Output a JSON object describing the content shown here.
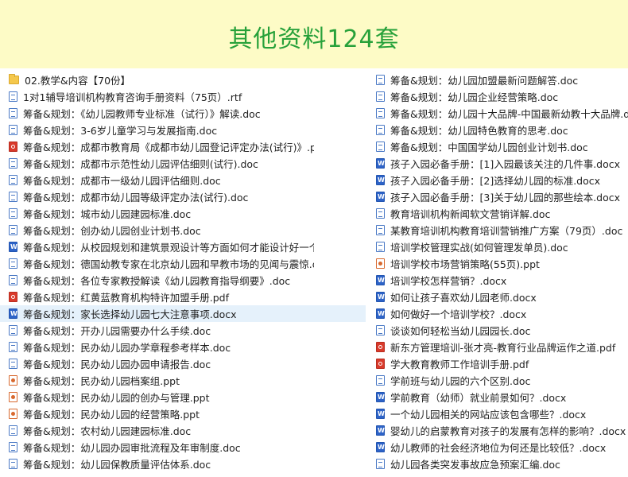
{
  "banner": {
    "title": "其他资料124套"
  },
  "left_items": [
    {
      "icon": "folder",
      "name": "02.教学&内容【70份】"
    },
    {
      "icon": "doc",
      "name": "1对1辅导培训机构教育咨询手册资料（75页）.rtf"
    },
    {
      "icon": "doc",
      "name": "筹备&规划：《幼儿园教师专业标准（试行）》解读.doc"
    },
    {
      "icon": "doc",
      "name": "筹备&规划：3-6岁儿童学习与发展指南.doc"
    },
    {
      "icon": "pdf",
      "name": "筹备&规划：成都市教育局《成都市幼儿园登记评定办法(试行)》.pdf"
    },
    {
      "icon": "doc",
      "name": "筹备&规划：成都市示范性幼儿园评估细则(试行).doc"
    },
    {
      "icon": "doc",
      "name": "筹备&规划：成都市一级幼儿园评估细则.doc"
    },
    {
      "icon": "doc",
      "name": "筹备&规划：成都市幼儿园等级评定办法(试行).doc"
    },
    {
      "icon": "doc",
      "name": "筹备&规划：城市幼儿园建园标准.doc"
    },
    {
      "icon": "doc",
      "name": "筹备&规划：创办幼儿园创业计划书.doc"
    },
    {
      "icon": "docx",
      "name": "筹备&规划：从校园规划和建筑景观设计等方面如何才能设计好一个学校？.docx"
    },
    {
      "icon": "doc",
      "name": "筹备&规划：德国幼教专家在北京幼儿园和早教市场的见闻与震惊.doc"
    },
    {
      "icon": "doc",
      "name": "筹备&规划：各位专家教授解读《幼儿园教育指导纲要》.doc"
    },
    {
      "icon": "pdf",
      "name": "筹备&规划：红黄蓝教育机构特许加盟手册.pdf"
    },
    {
      "icon": "docx",
      "name": "筹备&规划：家长选择幼儿园七大注意事项.docx",
      "selected": true
    },
    {
      "icon": "doc",
      "name": "筹备&规划：开办儿园需要办什么手续.doc"
    },
    {
      "icon": "doc",
      "name": "筹备&规划：民办幼儿园办学章程参考样本.doc"
    },
    {
      "icon": "doc",
      "name": "筹备&规划：民办幼儿园办园申请报告.doc"
    },
    {
      "icon": "ppt",
      "name": "筹备&规划：民办幼儿园档案组.ppt"
    },
    {
      "icon": "ppt",
      "name": "筹备&规划：民办幼儿园的创办与管理.ppt"
    },
    {
      "icon": "ppt",
      "name": "筹备&规划：民办幼儿园的经营策略.ppt"
    },
    {
      "icon": "doc",
      "name": "筹备&规划：农村幼儿园建园标准.doc"
    },
    {
      "icon": "doc",
      "name": "筹备&规划：幼儿园办园审批流程及年审制度.doc"
    },
    {
      "icon": "doc",
      "name": "筹备&规划：幼儿园保教质量评估体系.doc"
    }
  ],
  "right_items": [
    {
      "icon": "doc",
      "name": "筹备&规划：幼儿园加盟最新问题解答.doc"
    },
    {
      "icon": "doc",
      "name": "筹备&规划：幼儿园企业经营策略.doc"
    },
    {
      "icon": "doc",
      "name": "筹备&规划：幼儿园十大品牌-中国最新幼教十大品牌.doc"
    },
    {
      "icon": "doc",
      "name": "筹备&规划：幼儿园特色教育的思考.doc"
    },
    {
      "icon": "doc",
      "name": "筹备&规划：中国国学幼儿园创业计划书.doc"
    },
    {
      "icon": "docx",
      "name": "孩子入园必备手册：[1]入园最该关注的几件事.docx"
    },
    {
      "icon": "docx",
      "name": "孩子入园必备手册：[2]选择幼儿园的标准.docx"
    },
    {
      "icon": "docx",
      "name": "孩子入园必备手册：[3]关于幼儿园的那些绘本.docx"
    },
    {
      "icon": "doc",
      "name": "教育培训机构新闻软文营销详解.doc"
    },
    {
      "icon": "doc",
      "name": "某教育培训机构教育培训营销推广方案（79页）.doc"
    },
    {
      "icon": "doc",
      "name": "培训学校管理实战(如何管理发单员).doc"
    },
    {
      "icon": "ppt",
      "name": "培训学校市场营销策略(55页).ppt"
    },
    {
      "icon": "docx",
      "name": "培训学校怎样营销？.docx"
    },
    {
      "icon": "docx",
      "name": "如何让孩子喜欢幼儿园老师.docx"
    },
    {
      "icon": "docx",
      "name": "如何做好一个培训学校？.docx"
    },
    {
      "icon": "doc",
      "name": "谈谈如何轻松当幼儿园园长.doc"
    },
    {
      "icon": "pdf",
      "name": "新东方管理培训-张才亮-教育行业品牌运作之道.pdf"
    },
    {
      "icon": "pdf",
      "name": "学大教育教师工作培训手册.pdf"
    },
    {
      "icon": "doc",
      "name": "学前班与幼儿园的六个区别.doc"
    },
    {
      "icon": "docx",
      "name": "学前教育（幼师）就业前景如何？.docx"
    },
    {
      "icon": "docx",
      "name": "一个幼儿园相关的网站应该包含哪些？.docx"
    },
    {
      "icon": "docx",
      "name": "婴幼儿的启蒙教育对孩子的发展有怎样的影响？.docx"
    },
    {
      "icon": "docx",
      "name": "幼儿教师的社会经济地位为何还是比较低？.docx"
    },
    {
      "icon": "doc",
      "name": "幼儿园各类突发事故应急预案汇编.doc"
    }
  ],
  "colors": {
    "banner_bg": "#fdfbc6",
    "banner_text": "#27a13a",
    "selection": "#e5f1fb"
  }
}
